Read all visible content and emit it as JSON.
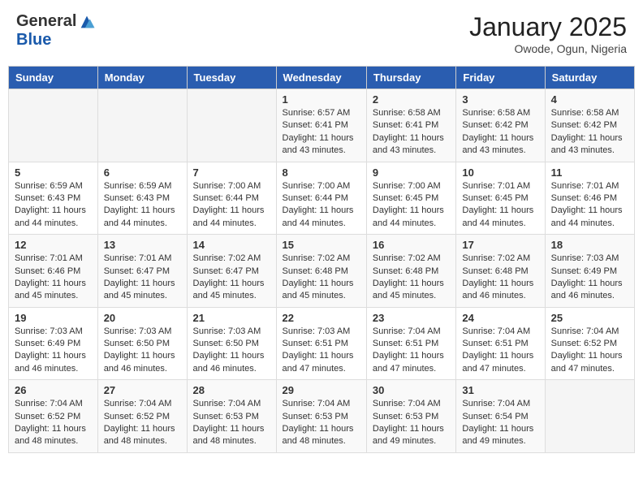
{
  "header": {
    "logo_general": "General",
    "logo_blue": "Blue",
    "month_title": "January 2025",
    "location": "Owode, Ogun, Nigeria"
  },
  "weekdays": [
    "Sunday",
    "Monday",
    "Tuesday",
    "Wednesday",
    "Thursday",
    "Friday",
    "Saturday"
  ],
  "weeks": [
    [
      {
        "day": "",
        "info": ""
      },
      {
        "day": "",
        "info": ""
      },
      {
        "day": "",
        "info": ""
      },
      {
        "day": "1",
        "info": "Sunrise: 6:57 AM\nSunset: 6:41 PM\nDaylight: 11 hours and 43 minutes."
      },
      {
        "day": "2",
        "info": "Sunrise: 6:58 AM\nSunset: 6:41 PM\nDaylight: 11 hours and 43 minutes."
      },
      {
        "day": "3",
        "info": "Sunrise: 6:58 AM\nSunset: 6:42 PM\nDaylight: 11 hours and 43 minutes."
      },
      {
        "day": "4",
        "info": "Sunrise: 6:58 AM\nSunset: 6:42 PM\nDaylight: 11 hours and 43 minutes."
      }
    ],
    [
      {
        "day": "5",
        "info": "Sunrise: 6:59 AM\nSunset: 6:43 PM\nDaylight: 11 hours and 44 minutes."
      },
      {
        "day": "6",
        "info": "Sunrise: 6:59 AM\nSunset: 6:43 PM\nDaylight: 11 hours and 44 minutes."
      },
      {
        "day": "7",
        "info": "Sunrise: 7:00 AM\nSunset: 6:44 PM\nDaylight: 11 hours and 44 minutes."
      },
      {
        "day": "8",
        "info": "Sunrise: 7:00 AM\nSunset: 6:44 PM\nDaylight: 11 hours and 44 minutes."
      },
      {
        "day": "9",
        "info": "Sunrise: 7:00 AM\nSunset: 6:45 PM\nDaylight: 11 hours and 44 minutes."
      },
      {
        "day": "10",
        "info": "Sunrise: 7:01 AM\nSunset: 6:45 PM\nDaylight: 11 hours and 44 minutes."
      },
      {
        "day": "11",
        "info": "Sunrise: 7:01 AM\nSunset: 6:46 PM\nDaylight: 11 hours and 44 minutes."
      }
    ],
    [
      {
        "day": "12",
        "info": "Sunrise: 7:01 AM\nSunset: 6:46 PM\nDaylight: 11 hours and 45 minutes."
      },
      {
        "day": "13",
        "info": "Sunrise: 7:01 AM\nSunset: 6:47 PM\nDaylight: 11 hours and 45 minutes."
      },
      {
        "day": "14",
        "info": "Sunrise: 7:02 AM\nSunset: 6:47 PM\nDaylight: 11 hours and 45 minutes."
      },
      {
        "day": "15",
        "info": "Sunrise: 7:02 AM\nSunset: 6:48 PM\nDaylight: 11 hours and 45 minutes."
      },
      {
        "day": "16",
        "info": "Sunrise: 7:02 AM\nSunset: 6:48 PM\nDaylight: 11 hours and 45 minutes."
      },
      {
        "day": "17",
        "info": "Sunrise: 7:02 AM\nSunset: 6:48 PM\nDaylight: 11 hours and 46 minutes."
      },
      {
        "day": "18",
        "info": "Sunrise: 7:03 AM\nSunset: 6:49 PM\nDaylight: 11 hours and 46 minutes."
      }
    ],
    [
      {
        "day": "19",
        "info": "Sunrise: 7:03 AM\nSunset: 6:49 PM\nDaylight: 11 hours and 46 minutes."
      },
      {
        "day": "20",
        "info": "Sunrise: 7:03 AM\nSunset: 6:50 PM\nDaylight: 11 hours and 46 minutes."
      },
      {
        "day": "21",
        "info": "Sunrise: 7:03 AM\nSunset: 6:50 PM\nDaylight: 11 hours and 46 minutes."
      },
      {
        "day": "22",
        "info": "Sunrise: 7:03 AM\nSunset: 6:51 PM\nDaylight: 11 hours and 47 minutes."
      },
      {
        "day": "23",
        "info": "Sunrise: 7:04 AM\nSunset: 6:51 PM\nDaylight: 11 hours and 47 minutes."
      },
      {
        "day": "24",
        "info": "Sunrise: 7:04 AM\nSunset: 6:51 PM\nDaylight: 11 hours and 47 minutes."
      },
      {
        "day": "25",
        "info": "Sunrise: 7:04 AM\nSunset: 6:52 PM\nDaylight: 11 hours and 47 minutes."
      }
    ],
    [
      {
        "day": "26",
        "info": "Sunrise: 7:04 AM\nSunset: 6:52 PM\nDaylight: 11 hours and 48 minutes."
      },
      {
        "day": "27",
        "info": "Sunrise: 7:04 AM\nSunset: 6:52 PM\nDaylight: 11 hours and 48 minutes."
      },
      {
        "day": "28",
        "info": "Sunrise: 7:04 AM\nSunset: 6:53 PM\nDaylight: 11 hours and 48 minutes."
      },
      {
        "day": "29",
        "info": "Sunrise: 7:04 AM\nSunset: 6:53 PM\nDaylight: 11 hours and 48 minutes."
      },
      {
        "day": "30",
        "info": "Sunrise: 7:04 AM\nSunset: 6:53 PM\nDaylight: 11 hours and 49 minutes."
      },
      {
        "day": "31",
        "info": "Sunrise: 7:04 AM\nSunset: 6:54 PM\nDaylight: 11 hours and 49 minutes."
      },
      {
        "day": "",
        "info": ""
      }
    ]
  ]
}
